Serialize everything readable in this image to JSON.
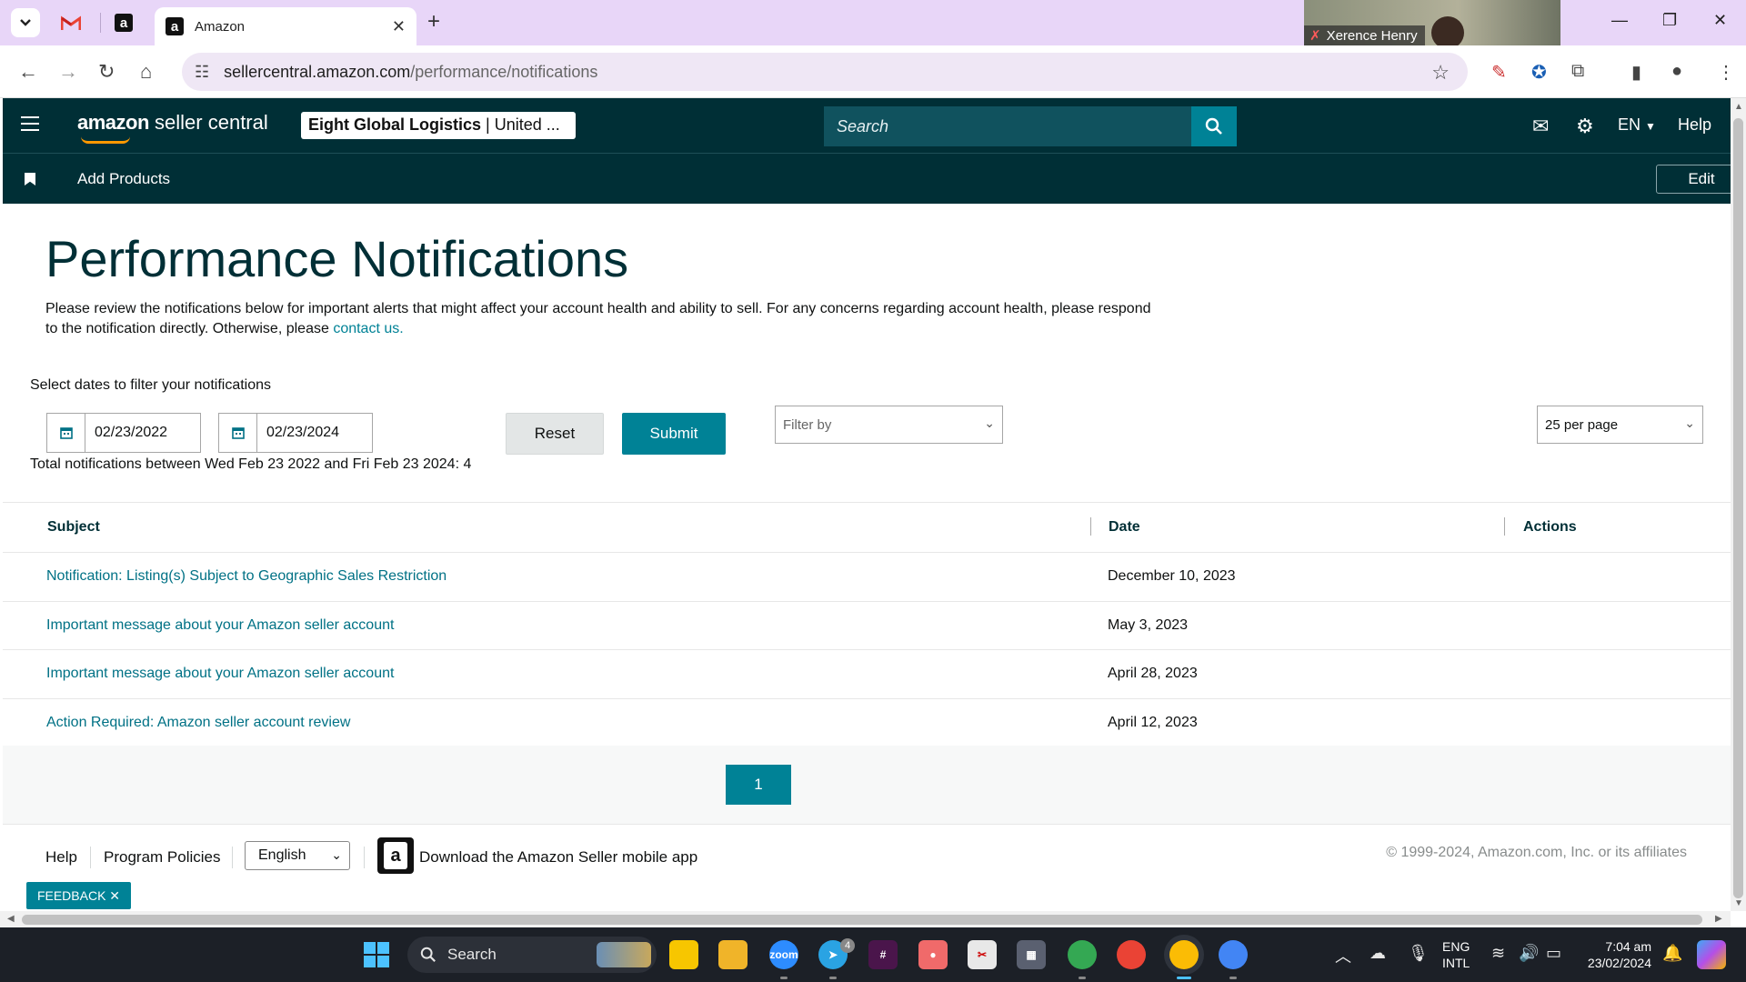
{
  "browser": {
    "active_tab_title": "Amazon",
    "url_host": "sellercentral.amazon.com",
    "url_path": "/performance/notifications",
    "video_participant": "Xerence Henry"
  },
  "header": {
    "logo_brand": "amazon",
    "logo_suffix": " seller central",
    "account_name": "Eight Global Logistics",
    "account_region": " | United ...",
    "search_placeholder": "Search",
    "language": "EN",
    "help": "Help"
  },
  "subnav": {
    "add_products": "Add Products",
    "edit": "Edit"
  },
  "page": {
    "title": "Performance Notifications",
    "intro_text": "Please review the notifications below for important alerts that might affect your account health and ability to sell. For any concerns regarding account health, please respond to the notification directly. Otherwise, please ",
    "contact_link": "contact us.",
    "filter_label": "Select dates to filter your notifications",
    "start_date": "02/23/2022",
    "end_date": "02/23/2024",
    "reset": "Reset",
    "submit": "Submit",
    "filter_by": "Filter by",
    "per_page": "25 per page",
    "total": "Total notifications between Wed Feb 23 2022 and Fri Feb 23 2024: 4"
  },
  "table": {
    "headers": [
      "Subject",
      "Date",
      "Actions"
    ],
    "rows": [
      {
        "subject": "Notification: Listing(s) Subject to Geographic Sales Restriction",
        "date": "December 10, 2023"
      },
      {
        "subject": "Important message about your Amazon seller account",
        "date": "May 3, 2023"
      },
      {
        "subject": "Important message about your Amazon seller account",
        "date": "April 28, 2023"
      },
      {
        "subject": "Action Required: Amazon seller account review",
        "date": "April 12, 2023"
      }
    ]
  },
  "pagination": {
    "current_page": "1"
  },
  "footer": {
    "help": "Help",
    "program_policies": "Program Policies",
    "language": "English",
    "download_app": "Download the Amazon Seller mobile app",
    "copyright": "© 1999-2024, Amazon.com, Inc. or its affiliates",
    "feedback": "FEEDBACK ✕"
  },
  "taskbar": {
    "search": "Search",
    "lang_line1": "ENG",
    "lang_line2": "INTL",
    "time": "7:04 am",
    "date": "23/02/2024",
    "telegram_badge": "4"
  },
  "colors": {
    "header_bg": "#002f36",
    "accent": "#008296",
    "link": "#007185"
  }
}
